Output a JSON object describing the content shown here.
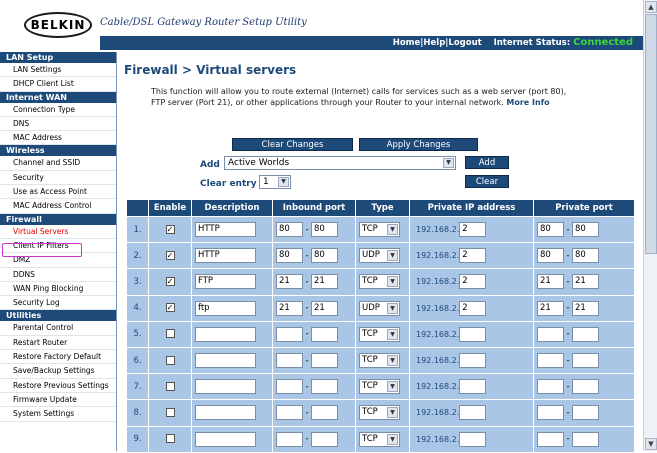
{
  "header": {
    "logo": "BELKIN",
    "title": "Cable/DSL Gateway Router Setup Utility",
    "links": [
      "Home",
      "Help",
      "Logout"
    ],
    "status_label": "Internet Status:",
    "status_value": "Connected",
    "status_color": "#3cd43c"
  },
  "sidebar": {
    "sections": [
      {
        "title": "LAN Setup",
        "items": [
          "LAN Settings",
          "DHCP Client List"
        ]
      },
      {
        "title": "Internet WAN",
        "items": [
          "Connection Type",
          "DNS",
          "MAC Address"
        ]
      },
      {
        "title": "Wireless",
        "items": [
          "Channel and SSID",
          "Security",
          "Use as Access Point",
          "MAC Address Control"
        ]
      },
      {
        "title": "Firewall",
        "items": [
          "Virtual Servers",
          "Client IP Filters",
          "DMZ",
          "DDNS",
          "WAN Ping Blocking",
          "Security Log"
        ]
      },
      {
        "title": "Utilities",
        "items": [
          "Parental Control",
          "Restart Router",
          "Restore Factory Default",
          "Save/Backup Settings",
          "Restore Previous Settings",
          "Firmware Update",
          "System Settings"
        ]
      }
    ],
    "active_item": "Virtual Servers"
  },
  "page": {
    "title": "Firewall > Virtual servers",
    "description": "This function will allow you to route external (Internet) calls for services such as a web server (port 80), FTP server (Port 21), or other applications through your Router to your internal network.",
    "more_info": "More Info",
    "clear_changes": "Clear Changes",
    "apply_changes": "Apply Changes",
    "add_label": "Add",
    "add_selected": "Active Worlds",
    "add_button": "Add",
    "clear_entry_label": "Clear entry",
    "clear_entry_selected": "1",
    "clear_button": "Clear"
  },
  "table": {
    "headers": [
      "",
      "Enable",
      "Description",
      "Inbound port",
      "Type",
      "Private IP address",
      "Private port"
    ],
    "ip_prefix": "192.168.2.",
    "rows": [
      {
        "num": "1.",
        "enabled": true,
        "desc": "HTTP",
        "in_from": "80",
        "in_to": "80",
        "type": "TCP",
        "ip": "2",
        "p_from": "80",
        "p_to": "80"
      },
      {
        "num": "2.",
        "enabled": true,
        "desc": "HTTP",
        "in_from": "80",
        "in_to": "80",
        "type": "UDP",
        "ip": "2",
        "p_from": "80",
        "p_to": "80"
      },
      {
        "num": "3.",
        "enabled": true,
        "desc": "FTP",
        "in_from": "21",
        "in_to": "21",
        "type": "TCP",
        "ip": "2",
        "p_from": "21",
        "p_to": "21"
      },
      {
        "num": "4.",
        "enabled": true,
        "desc": "ftp",
        "in_from": "21",
        "in_to": "21",
        "type": "UDP",
        "ip": "2",
        "p_from": "21",
        "p_to": "21"
      },
      {
        "num": "5.",
        "enabled": false,
        "desc": "",
        "in_from": "",
        "in_to": "",
        "type": "TCP",
        "ip": "",
        "p_from": "",
        "p_to": ""
      },
      {
        "num": "6.",
        "enabled": false,
        "desc": "",
        "in_from": "",
        "in_to": "",
        "type": "TCP",
        "ip": "",
        "p_from": "",
        "p_to": ""
      },
      {
        "num": "7.",
        "enabled": false,
        "desc": "",
        "in_from": "",
        "in_to": "",
        "type": "TCP",
        "ip": "",
        "p_from": "",
        "p_to": ""
      },
      {
        "num": "8.",
        "enabled": false,
        "desc": "",
        "in_from": "",
        "in_to": "",
        "type": "TCP",
        "ip": "",
        "p_from": "",
        "p_to": ""
      },
      {
        "num": "9.",
        "enabled": false,
        "desc": "",
        "in_from": "",
        "in_to": "",
        "type": "TCP",
        "ip": "",
        "p_from": "",
        "p_to": ""
      }
    ]
  },
  "colors": {
    "nav_blue": "#1e4a7a",
    "row_blue": "#a9c6e6",
    "active_red": "#dd0000",
    "highlight_magenta": "#cc33cc"
  }
}
